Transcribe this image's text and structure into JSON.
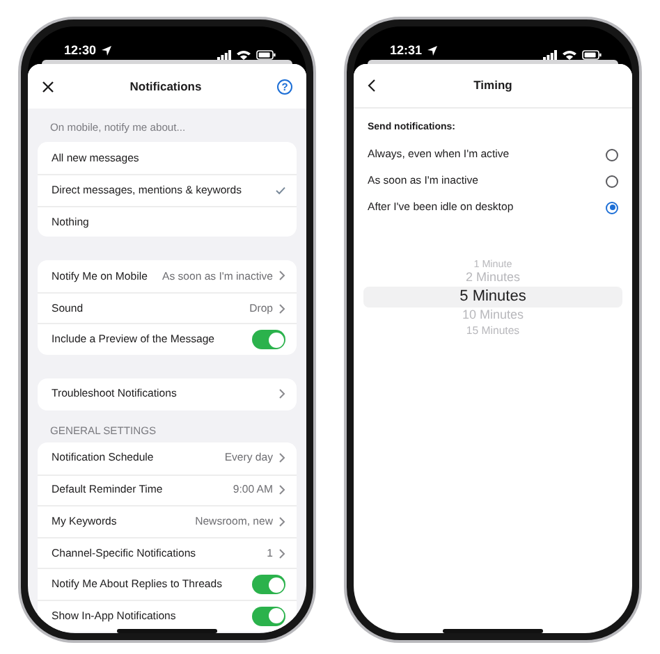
{
  "notifications_screen": {
    "time": "12:30",
    "title": "Notifications",
    "help_glyph": "?",
    "section_label": "On mobile, notify me about...",
    "options": [
      {
        "label": "All new messages",
        "selected": false
      },
      {
        "label": "Direct messages, mentions & keywords",
        "selected": true
      },
      {
        "label": "Nothing",
        "selected": false
      }
    ],
    "mobile_rows": [
      {
        "kind": "link",
        "label": "Notify Me on Mobile",
        "value": "As soon as I'm inactive"
      },
      {
        "kind": "link",
        "label": "Sound",
        "value": "Drop"
      },
      {
        "kind": "toggle",
        "label": "Include a Preview of the Message",
        "on": true
      }
    ],
    "troubleshoot_rows": [
      {
        "kind": "link",
        "label": "Troubleshoot Notifications"
      }
    ],
    "general_heading": "GENERAL SETTINGS",
    "general_rows": [
      {
        "kind": "link",
        "label": "Notification Schedule",
        "value": "Every day"
      },
      {
        "kind": "link",
        "label": "Default Reminder Time",
        "value": "9:00 AM"
      },
      {
        "kind": "link",
        "label": "My Keywords",
        "value": "Newsroom, new"
      },
      {
        "kind": "link",
        "label": "Channel-Specific Notifications",
        "value": "1"
      },
      {
        "kind": "toggle",
        "label": "Notify Me About Replies to Threads",
        "on": true
      },
      {
        "kind": "toggle",
        "label": "Show In-App Notifications",
        "on": true
      }
    ]
  },
  "timing_screen": {
    "time": "12:31",
    "title": "Timing",
    "prompt": "Send notifications:",
    "choices": [
      {
        "label": "Always, even when I'm active",
        "selected": false
      },
      {
        "label": "As soon as I'm inactive",
        "selected": false
      },
      {
        "label": "After I've been idle on desktop",
        "selected": true
      }
    ],
    "picker": [
      {
        "label": "1 Minute",
        "selected": false
      },
      {
        "label": "2 Minutes",
        "selected": false
      },
      {
        "label": "5 Minutes",
        "selected": true
      },
      {
        "label": "10 Minutes",
        "selected": false
      },
      {
        "label": "15 Minutes",
        "selected": false
      }
    ]
  }
}
